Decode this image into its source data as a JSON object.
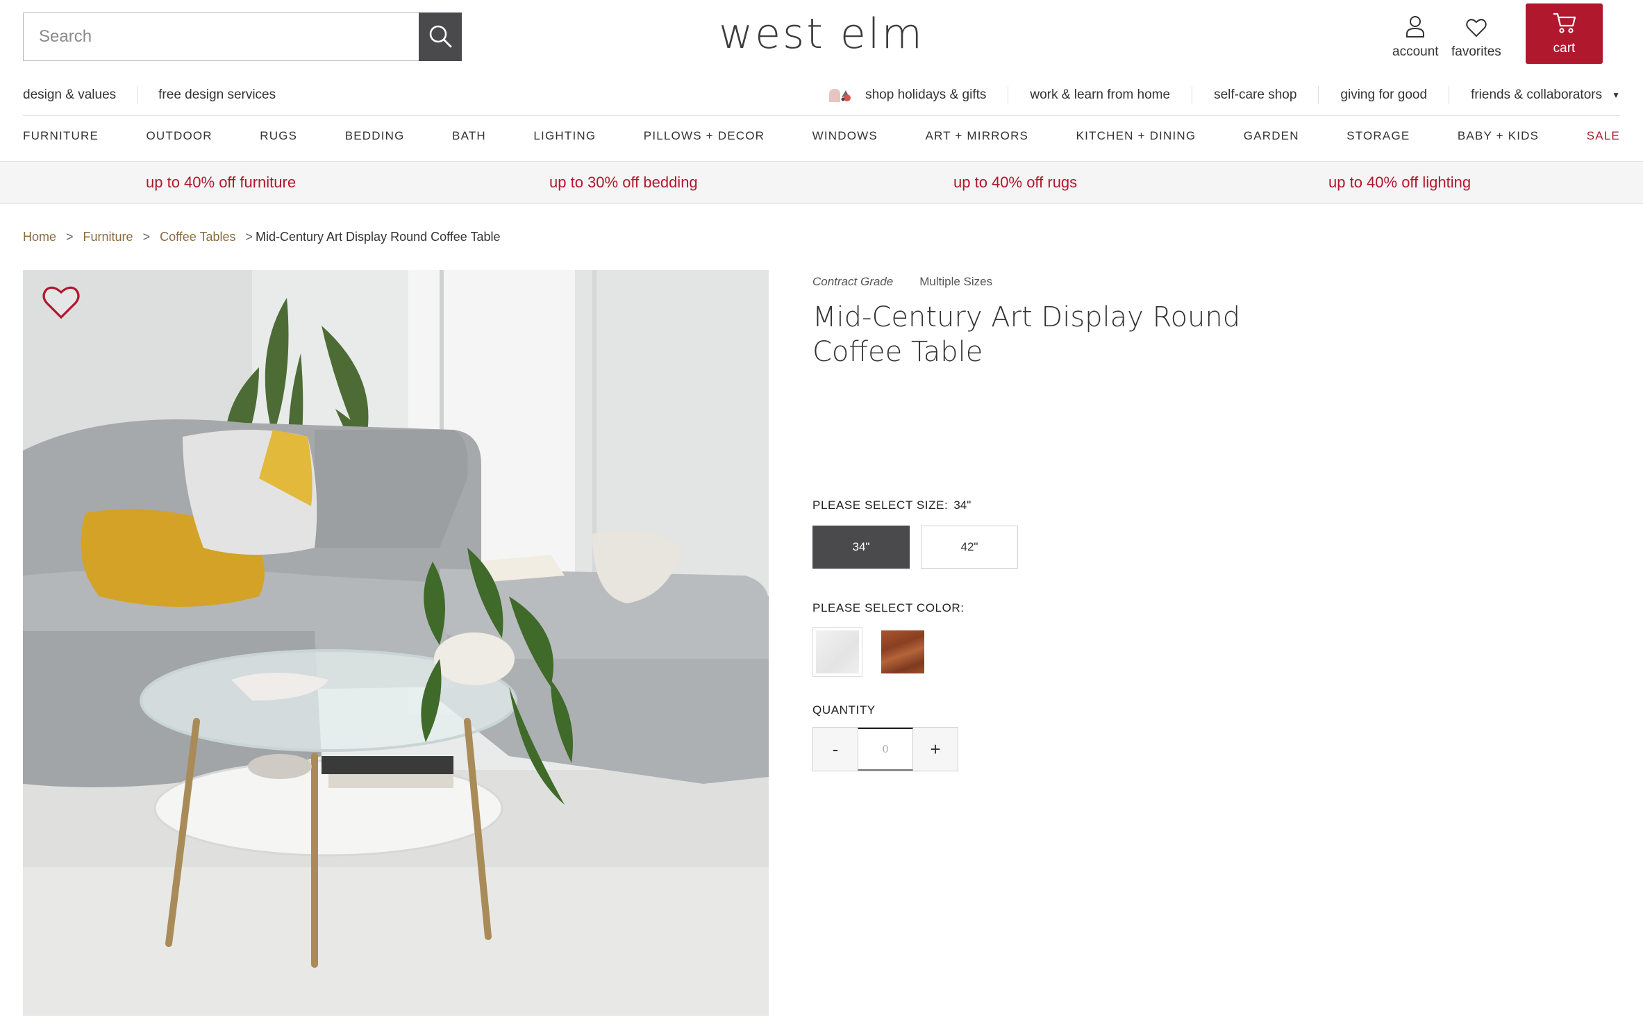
{
  "header": {
    "search": {
      "placeholder": "Search",
      "value": ""
    },
    "logo": "west elm",
    "account_label": "account",
    "favorites_label": "favorites",
    "cart_label": "cart"
  },
  "secondary_nav": {
    "left": [
      "design & values",
      "free design services"
    ],
    "right": [
      "shop holidays & gifts",
      "work & learn from home",
      "self-care shop",
      "giving for good",
      "friends & collaborators"
    ]
  },
  "main_nav": [
    "FURNITURE",
    "OUTDOOR",
    "RUGS",
    "BEDDING",
    "BATH",
    "LIGHTING",
    "PILLOWS + DECOR",
    "WINDOWS",
    "ART + MIRRORS",
    "KITCHEN + DINING",
    "GARDEN",
    "STORAGE",
    "BABY + KIDS",
    "SALE"
  ],
  "promos": [
    "up to 40% off furniture",
    "up to 30% off bedding",
    "up to 40% off rugs",
    "up to 40% off lighting"
  ],
  "breadcrumb": {
    "items": [
      "Home",
      "Furniture",
      "Coffee Tables"
    ],
    "separator": ">",
    "current": "Mid-Century Art Display Round Coffee Table"
  },
  "product": {
    "tags": [
      "Contract Grade",
      "Multiple Sizes"
    ],
    "title": "Mid-Century Art Display Round Coffee Table",
    "size_label": "PLEASE SELECT SIZE:",
    "size_selected": "34\"",
    "sizes": [
      "34\"",
      "42\""
    ],
    "color_label": "PLEASE SELECT COLOR:",
    "colors": [
      "white",
      "walnut"
    ],
    "quantity_label": "QUANTITY",
    "quantity_value": "0",
    "qty_minus": "-",
    "qty_plus": "+"
  },
  "colors": {
    "brand_red": "#b0182e",
    "dark_gray": "#4a4a4d",
    "breadcrumb_link": "#8a6c3c"
  },
  "icons": [
    "search-icon",
    "account-icon",
    "heart-icon",
    "cart-icon",
    "gift-icon",
    "chevron-down-icon"
  ]
}
